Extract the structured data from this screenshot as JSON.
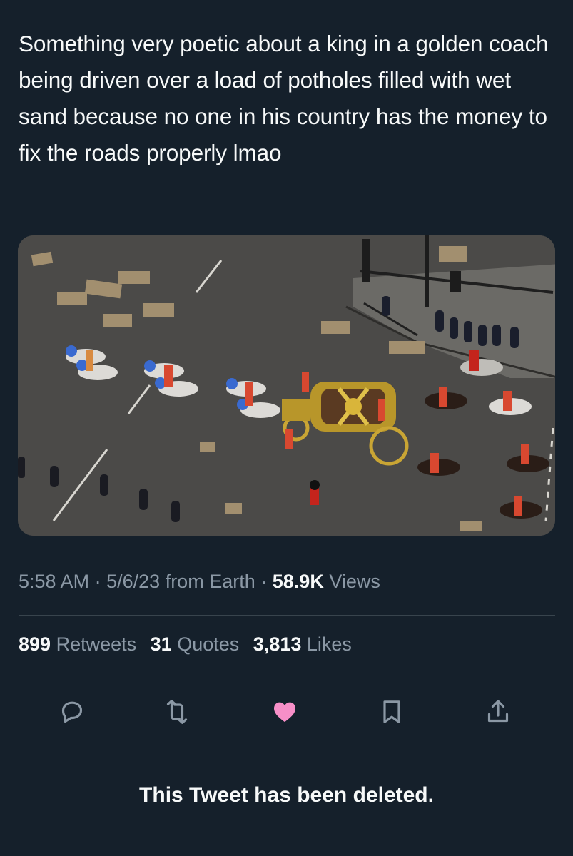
{
  "tweet": {
    "text": "Something very poetic about a king in a golden coach being driven over a load of potholes filled with wet sand because no one in his country has the money to fix the roads properly lmao",
    "media": {
      "label": "Aerial photo of a golden state coach pulled by horses along a road with sand-filled potholes"
    },
    "time": "5:58 AM",
    "date": "5/6/23",
    "source": "from Earth",
    "views_count": "58.9K",
    "views_label": "Views",
    "sep": "·"
  },
  "stats": {
    "retweets_count": "899",
    "retweets_label": "Retweets",
    "quotes_count": "31",
    "quotes_label": "Quotes",
    "likes_count": "3,813",
    "likes_label": "Likes"
  },
  "actions": {
    "reply_icon": "reply-icon",
    "retweet_icon": "retweet-icon",
    "like_icon": "heart-icon",
    "bookmark_icon": "bookmark-icon",
    "share_icon": "share-icon"
  },
  "colors": {
    "background": "#15202b",
    "text": "#f7f9f9",
    "secondary": "#8b98a5",
    "like": "#f91880"
  },
  "notice": "This Tweet has been deleted."
}
